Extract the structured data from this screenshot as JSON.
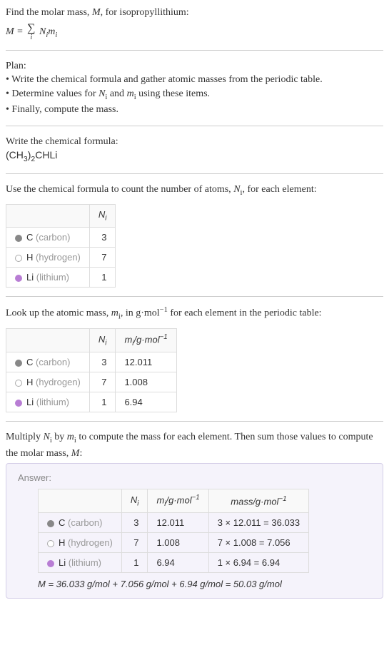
{
  "intro": {
    "line1_prefix": "Find the molar mass, ",
    "line1_var": "M",
    "line1_suffix": ", for isopropyllithium:",
    "formula_lhs": "M",
    "formula_eq": " = ",
    "formula_sum_idx": "i",
    "formula_rhs1": "N",
    "formula_rhs1_sub": "i",
    "formula_rhs2": "m",
    "formula_rhs2_sub": "i"
  },
  "plan": {
    "title": "Plan:",
    "bullet1": "• Write the chemical formula and gather atomic masses from the periodic table.",
    "bullet2_prefix": "• Determine values for ",
    "bullet2_var1": "N",
    "bullet2_var1_sub": "i",
    "bullet2_mid": " and ",
    "bullet2_var2": "m",
    "bullet2_var2_sub": "i",
    "bullet2_suffix": " using these items.",
    "bullet3": "• Finally, compute the mass."
  },
  "chem": {
    "title": "Write the chemical formula:",
    "part1": "(CH",
    "sub1": "3",
    "part2": ")",
    "sub2": "2",
    "part3": "CHLi"
  },
  "count": {
    "text_prefix": "Use the chemical formula to count the number of atoms, ",
    "var": "N",
    "var_sub": "i",
    "text_suffix": ", for each element:",
    "header_ni": "N",
    "header_ni_sub": "i"
  },
  "elements": {
    "carbon": {
      "symbol": "C",
      "name": "(carbon)",
      "n": "3",
      "m": "12.011",
      "mass": "3 × 12.011 = 36.033"
    },
    "hydrogen": {
      "symbol": "H",
      "name": "(hydrogen)",
      "n": "7",
      "m": "1.008",
      "mass": "7 × 1.008 = 7.056"
    },
    "lithium": {
      "symbol": "Li",
      "name": "(lithium)",
      "n": "1",
      "m": "6.94",
      "mass": "1 × 6.94 = 6.94"
    }
  },
  "lookup": {
    "text_prefix": "Look up the atomic mass, ",
    "var": "m",
    "var_sub": "i",
    "text_mid": ", in g·mol",
    "text_sup": "−1",
    "text_suffix": " for each element in the periodic table:",
    "header_mi": "m",
    "header_mi_sub": "i",
    "header_mi_unit": "/g·mol",
    "header_mi_sup": "−1"
  },
  "compute": {
    "text_prefix": "Multiply ",
    "var1": "N",
    "var1_sub": "i",
    "text_mid1": " by ",
    "var2": "m",
    "var2_sub": "i",
    "text_mid2": " to compute the mass for each element. Then sum those values to compute the molar mass, ",
    "var3": "M",
    "text_suffix": ":"
  },
  "answer": {
    "label": "Answer:",
    "header_mass": "mass/g·mol",
    "header_mass_sup": "−1",
    "final_var": "M",
    "final_text": " = 36.033 g/mol + 7.056 g/mol + 6.94 g/mol = 50.03 g/mol"
  }
}
